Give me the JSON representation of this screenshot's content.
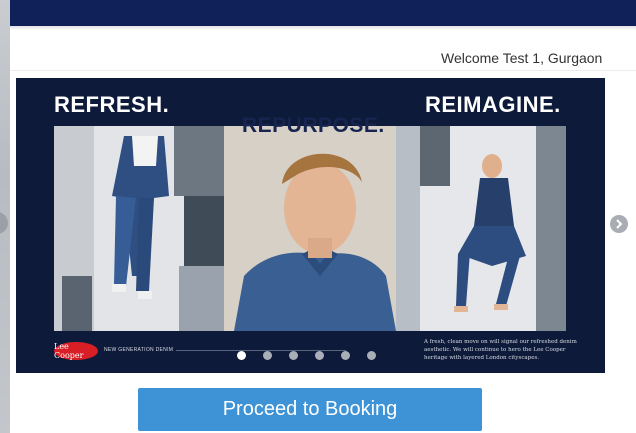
{
  "header": {
    "welcome_text": "Welcome Test 1, Gurgaon"
  },
  "banner": {
    "words": [
      "REFRESH.",
      "REPURPOSE.",
      "REIMAGINE."
    ],
    "logo_text": "Lee Cooper",
    "tagline": "NEW GENERATION DENIM",
    "blurb": "A fresh, clean move on will signal our refreshed denim aesthetic. We will continue to hero the Lee Cooper heritage with layered London cityscapes.",
    "slide_count": 6,
    "active_slide": 1
  },
  "actions": {
    "proceed_label": "Proceed to Booking"
  },
  "colors": {
    "topbar": "#0f2158",
    "banner_bg": "#0d1a3a",
    "proceed_button": "#3d93d6"
  }
}
